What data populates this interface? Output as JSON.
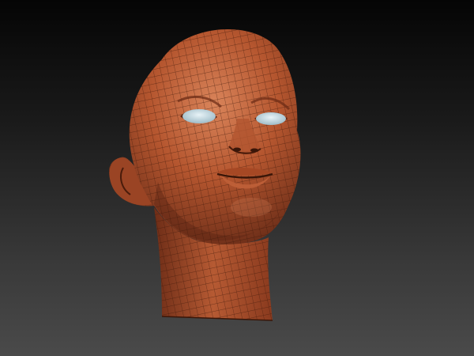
{
  "viewport": {
    "background_top": "#050505",
    "background_bottom": "#4a4a4a"
  },
  "model": {
    "subject": "sculpted-head-mesh",
    "material_color": "#b5562f",
    "material_shadow": "#5e2614",
    "material_highlight": "#d9845a",
    "wireframe_color": "#3a1608",
    "eye_color": "#cfe4ec",
    "wireframe_visible": true
  }
}
